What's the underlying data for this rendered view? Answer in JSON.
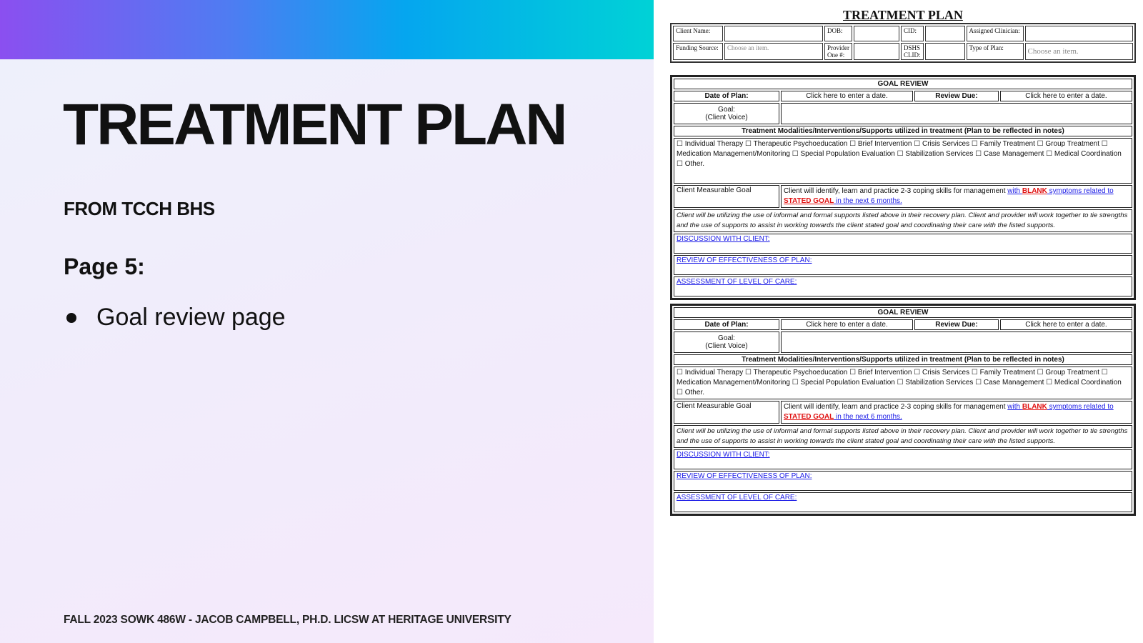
{
  "slide": {
    "title": "TREATMENT PLAN",
    "subtitle": "FROM TCCH BHS",
    "page_label": "Page 5:",
    "bullets": [
      "Goal review page"
    ],
    "footer": "FALL 2023 SOWK 486W - JACOB CAMPBELL, PH.D. LICSW AT HERITAGE UNIVERSITY",
    "gradient_colors": [
      "#8b4ff0",
      "#4f7cf2",
      "#05a6ef",
      "#00d2d6"
    ]
  },
  "document": {
    "title": "TREATMENT PLAN",
    "header": {
      "client_name": "Client Name:",
      "dob": "DOB:",
      "cid": "CID:",
      "assigned_clinician": "Assigned Clinician:",
      "funding_source": "Funding Source:",
      "funding_placeholder": "Choose an item.",
      "provider_one": "Provider One #:",
      "dshs_clid": "DSHS CLID:",
      "type_of_plan": "Type of Plan:",
      "type_placeholder": "Choose an item."
    },
    "goal_review": {
      "heading": "GOAL REVIEW",
      "date_of_plan": "Date of Plan:",
      "date_placeholder": "Click here to enter a date.",
      "review_due": "Review Due:",
      "goal_label_1": "Goal:",
      "goal_label_2": "(Client Voice)",
      "modalities_heading": "Treatment Modalities/Interventions/Supports utilized in treatment (Plan to be reflected in notes)",
      "modalities": "☐ Individual Therapy ☐ Therapeutic Psychoeducation ☐ Brief Intervention ☐ Crisis Services ☐ Family Treatment ☐ Group Treatment ☐ Medication Management/Monitoring ☐ Special Population Evaluation ☐ Stabilization Services ☐ Case Management ☐ Medical Coordination  ☐ Other.",
      "measurable_goal_label": "Client Measurable Goal",
      "measurable_goal_text": "Client will identify, learn and practice 2-3 coping skills for management ",
      "mg_with": "with ",
      "mg_blank": "BLANK",
      "mg_symptoms": " symptoms related to",
      "mg_stated": "STATED GOAL",
      "mg_end": " in the next 6 months.",
      "supports_text": "Client will be utilizing the use of informal and formal supports listed above in their recovery plan.  Client and provider will work together to tie strengths and the use of supports to assist in working towards the client stated goal and coordinating their care with the listed supports.",
      "discussion": "DISCUSSION WITH CLIENT:",
      "review_effectiveness": "REVIEW OF EFFECTIVENESS OF PLAN:",
      "assessment": "ASSESSMENT OF LEVEL OF CARE:"
    }
  }
}
